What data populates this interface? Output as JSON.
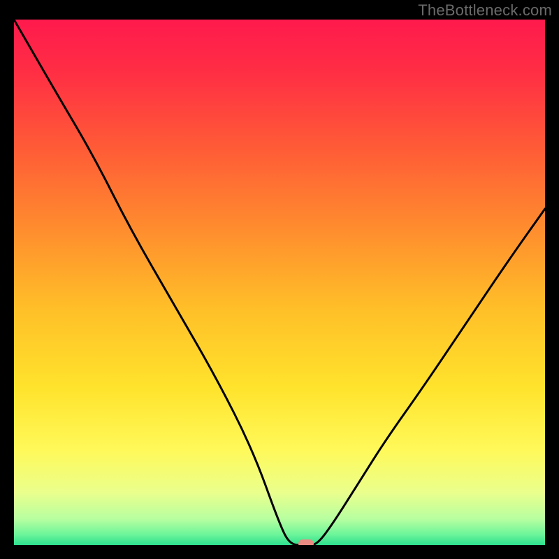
{
  "watermark": "TheBottleneck.com",
  "chart_data": {
    "type": "line",
    "title": "",
    "xlabel": "",
    "ylabel": "",
    "xlim": [
      0,
      100
    ],
    "ylim": [
      0,
      100
    ],
    "series": [
      {
        "name": "bottleneck-curve",
        "x": [
          0,
          8,
          15,
          22,
          30,
          38,
          45,
          50,
          52,
          55,
          57,
          60,
          65,
          70,
          77,
          85,
          93,
          100
        ],
        "values": [
          100,
          86,
          74,
          60,
          46,
          32,
          18,
          4,
          0,
          0,
          0,
          4,
          12,
          20,
          30,
          42,
          54,
          64
        ]
      }
    ],
    "marker": {
      "x": 55,
      "y": 0
    },
    "gradient_stops": [
      {
        "offset": 0.0,
        "color": "#ff1a4d"
      },
      {
        "offset": 0.1,
        "color": "#ff2e44"
      },
      {
        "offset": 0.25,
        "color": "#ff5d36"
      },
      {
        "offset": 0.4,
        "color": "#ff8d2e"
      },
      {
        "offset": 0.55,
        "color": "#ffbf28"
      },
      {
        "offset": 0.7,
        "color": "#ffe32c"
      },
      {
        "offset": 0.82,
        "color": "#fff95a"
      },
      {
        "offset": 0.9,
        "color": "#eaff8c"
      },
      {
        "offset": 0.95,
        "color": "#b8ffa0"
      },
      {
        "offset": 0.98,
        "color": "#6cf59a"
      },
      {
        "offset": 1.0,
        "color": "#2de08f"
      }
    ]
  }
}
